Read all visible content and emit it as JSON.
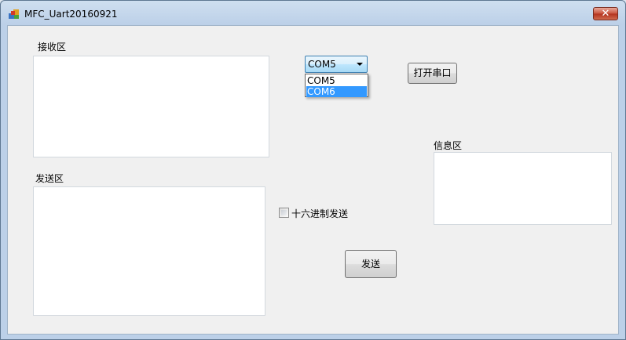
{
  "window": {
    "title": "MFC_Uart20160921",
    "close_glyph": "✕"
  },
  "receive": {
    "label": "接收区"
  },
  "send": {
    "label": "发送区"
  },
  "info": {
    "label": "信息区"
  },
  "port_combo": {
    "selected": "COM5",
    "options": [
      "COM5",
      "COM6"
    ],
    "highlighted": "COM6"
  },
  "open_port_button": "打开串口",
  "hex_send": {
    "label": "十六进制发送",
    "checked": false
  },
  "send_button": "发送",
  "icons": {
    "app": "app-icon",
    "close": "close-icon",
    "dropdown": "chevron-down-icon"
  },
  "colors": {
    "selection": "#3399ff",
    "close_button": "#c8523b"
  }
}
